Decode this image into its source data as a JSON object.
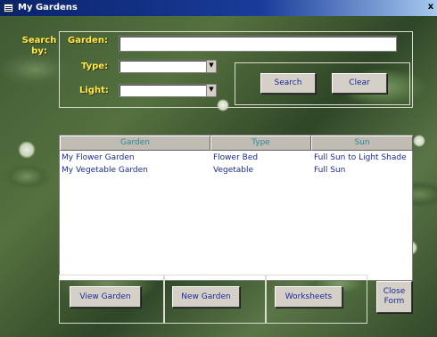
{
  "window": {
    "title": "My Gardens",
    "close_glyph": "x"
  },
  "search": {
    "search_by_label": "Search by:",
    "garden_label": "Garden:",
    "type_label": "Type:",
    "light_label": "Light:",
    "garden_value": "",
    "type_value": "",
    "light_value": "",
    "search_button": "Search",
    "clear_button": "Clear"
  },
  "list": {
    "columns": [
      "Garden",
      "Type",
      "Sun"
    ],
    "rows": [
      [
        "My Flower Garden",
        "Flower Bed",
        "Full Sun to Light Shade"
      ],
      [
        "My Vegetable Garden",
        "Vegetable",
        "Full Sun"
      ]
    ]
  },
  "footer": {
    "view_garden": "View Garden",
    "new_garden": "New Garden",
    "worksheets": "Worksheets",
    "close_form": "Close Form"
  },
  "icons": {
    "title": "form-icon",
    "dropdown": "chevron-down-icon"
  }
}
